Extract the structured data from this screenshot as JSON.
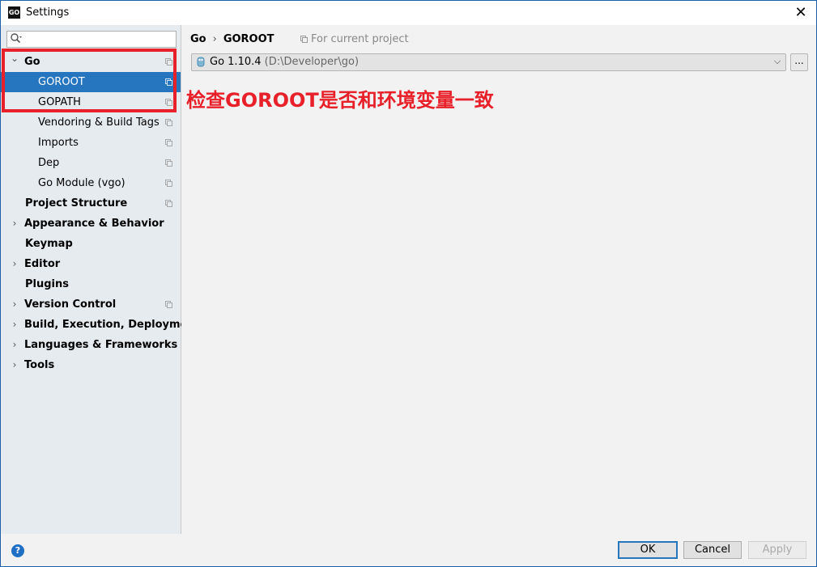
{
  "window": {
    "title": "Settings",
    "app_icon_text": "GO",
    "close_glyph": "✕"
  },
  "sidebar": {
    "search_placeholder": "",
    "items": [
      {
        "label": "Go",
        "bold": true,
        "arrow": "expanded",
        "copy_icon": true
      },
      {
        "label": "GOROOT",
        "bold": false,
        "selected": true,
        "copy_icon": true
      },
      {
        "label": "GOPATH",
        "bold": false,
        "copy_icon": true
      },
      {
        "label": "Vendoring & Build Tags",
        "bold": false,
        "copy_icon": true
      },
      {
        "label": "Imports",
        "bold": false,
        "copy_icon": true
      },
      {
        "label": "Dep",
        "bold": false,
        "copy_icon": true
      },
      {
        "label": "Go Module (vgo)",
        "bold": false,
        "copy_icon": true
      },
      {
        "label": "Project Structure",
        "bold": true,
        "copy_icon": true
      },
      {
        "label": "Appearance & Behavior",
        "bold": true,
        "arrow": "collapsed"
      },
      {
        "label": "Keymap",
        "bold": true
      },
      {
        "label": "Editor",
        "bold": true,
        "arrow": "collapsed"
      },
      {
        "label": "Plugins",
        "bold": true
      },
      {
        "label": "Version Control",
        "bold": true,
        "arrow": "collapsed",
        "copy_icon": true
      },
      {
        "label": "Build, Execution, Deployment",
        "bold": true,
        "arrow": "collapsed"
      },
      {
        "label": "Languages & Frameworks",
        "bold": true,
        "arrow": "collapsed"
      },
      {
        "label": "Tools",
        "bold": true,
        "arrow": "collapsed"
      }
    ]
  },
  "main": {
    "breadcrumb": [
      "Go",
      "GOROOT"
    ],
    "breadcrumb_sep": "›",
    "scope_label": "For current project",
    "sdk": {
      "name": "Go 1.10.4",
      "path": "(D:\\Developer\\go)"
    },
    "more_label": "..."
  },
  "annotation": {
    "text": "检查GOROOT是否和环境变量一致",
    "color": "#e8202a"
  },
  "footer": {
    "help_label": "?",
    "ok_label": "OK",
    "cancel_label": "Cancel",
    "apply_label": "Apply"
  },
  "colors": {
    "selection": "#2675bf",
    "sidebar_bg": "#e6ebf0",
    "annotation_red": "#e8202a"
  }
}
